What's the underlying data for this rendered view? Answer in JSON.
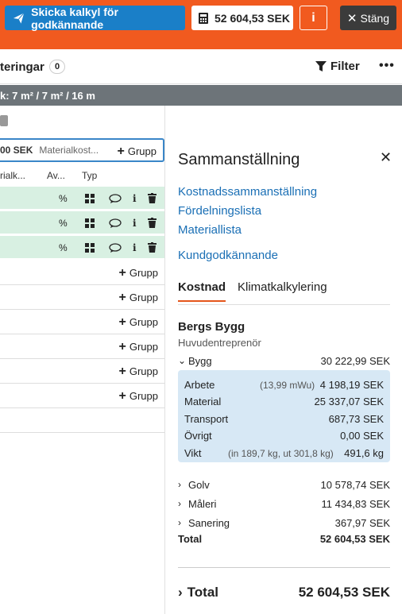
{
  "topbar": {
    "send_label": "Skicka kalkyl för godkännande",
    "total_label": "52 604,53 SEK",
    "info_label": "i",
    "close_label": "Stäng"
  },
  "toolbar": {
    "section_title": "teringar",
    "count": "0",
    "filter_label": "Filter",
    "more_label": "•••"
  },
  "greybar": {
    "text": "k: 7 m² / 7 m² / 16 m"
  },
  "group": {
    "amount": "00 SEK",
    "label": "Materialkost...",
    "add_label": "Grupp"
  },
  "columns": {
    "c1": "rialk...",
    "c2": "Av...",
    "c3": "Typ"
  },
  "rows": [
    {
      "add_label": "Grupp"
    },
    {
      "add_label": "Grupp"
    },
    {
      "add_label": "Grupp"
    },
    {
      "add_label": "Grupp"
    },
    {
      "add_label": "Grupp"
    },
    {
      "add_label": "Grupp"
    }
  ],
  "panel": {
    "title": "Sammanställning",
    "links": [
      "Kostnadssammanställning",
      "Fördelningslista",
      "Materiallista",
      "Kundgodkännande"
    ],
    "tabs": [
      "Kostnad",
      "Klimatkalkylering"
    ],
    "company": "Bergs Bygg",
    "role": "Huvudentreprenör",
    "categories": {
      "bygg": {
        "name": "Bygg",
        "value": "30 222,99 SEK"
      },
      "golv": {
        "name": "Golv",
        "value": "10 578,74 SEK"
      },
      "maleri": {
        "name": "Måleri",
        "value": "11 434,83 SEK"
      },
      "sanering": {
        "name": "Sanering",
        "value": "367,97 SEK"
      }
    },
    "details": {
      "arbete": {
        "label": "Arbete",
        "note": "(13,99 mWu)",
        "value": "4 198,19 SEK"
      },
      "material": {
        "label": "Material",
        "value": "25 337,07 SEK"
      },
      "transport": {
        "label": "Transport",
        "value": "687,73 SEK"
      },
      "ovrigt": {
        "label": "Övrigt",
        "value": "0,00 SEK"
      },
      "vikt": {
        "label": "Vikt",
        "note": "(in 189,7 kg, ut 301,8 kg)",
        "value": "491,6 kg"
      }
    },
    "total_label": "Total",
    "total_value": "52 604,53 SEK",
    "grand_label": "Total",
    "grand_value": "52 604,53 SEK"
  },
  "colors": {
    "brand_orange": "#f15a1f",
    "primary_blue": "#1a7fc8",
    "green_row": "#d8f0e2",
    "detail_bg": "#d7e8f5"
  }
}
